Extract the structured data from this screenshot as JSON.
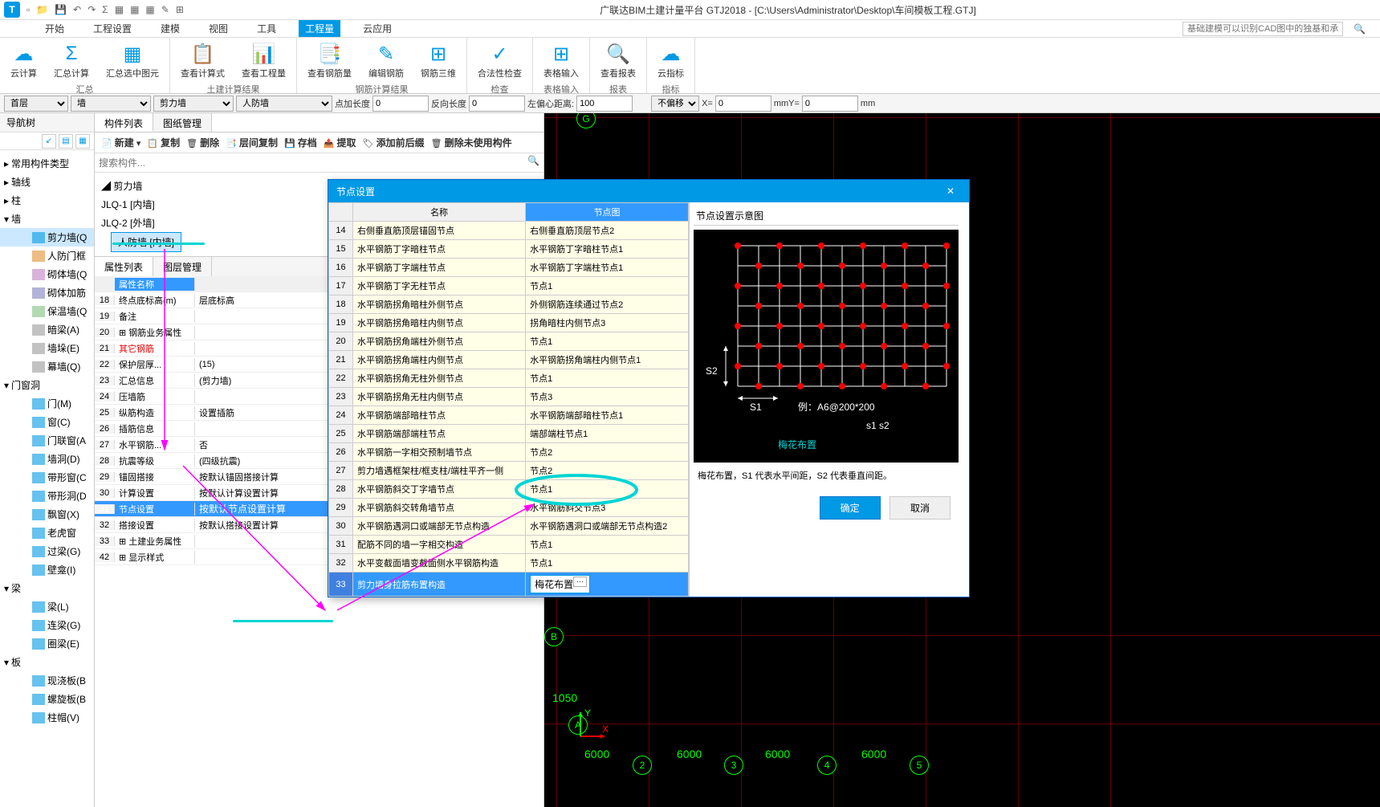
{
  "app": {
    "title": "广联达BIM土建计量平台 GTJ2018 - [C:\\Users\\Administrator\\Desktop\\车间模板工程.GTJ]"
  },
  "menu": {
    "items": [
      "开始",
      "工程设置",
      "建模",
      "视图",
      "工具",
      "工程量",
      "云应用"
    ],
    "active_index": 5,
    "search_placeholder": "基础建模可以识别CAD图中的独基和承台吗？"
  },
  "ribbon": {
    "groups": [
      {
        "label": "汇总",
        "items": [
          {
            "icon": "☁",
            "label": "云计算"
          },
          {
            "icon": "Σ",
            "label": "汇总计算"
          },
          {
            "icon": "▦",
            "label": "汇总选中图元"
          }
        ]
      },
      {
        "label": "土建计算结果",
        "items": [
          {
            "icon": "📋",
            "label": "查看计算式"
          },
          {
            "icon": "📊",
            "label": "查看工程量"
          }
        ]
      },
      {
        "label": "钢筋计算结果",
        "items": [
          {
            "icon": "📑",
            "label": "查看钢筋量"
          },
          {
            "icon": "✎",
            "label": "编辑钢筋"
          },
          {
            "icon": "⊞",
            "label": "钢筋三维"
          }
        ]
      },
      {
        "label": "检查",
        "items": [
          {
            "icon": "✓",
            "label": "合法性检查"
          }
        ]
      },
      {
        "label": "表格输入",
        "items": [
          {
            "icon": "⊞",
            "label": "表格输入"
          }
        ]
      },
      {
        "label": "报表",
        "items": [
          {
            "icon": "🔍",
            "label": "查看报表"
          }
        ]
      },
      {
        "label": "指标",
        "items": [
          {
            "icon": "☁",
            "label": "云指标"
          }
        ]
      }
    ]
  },
  "context": {
    "floor": "首层",
    "type": "墙",
    "subtype": "剪力墙",
    "member": "人防墙",
    "addlen_label": "点加长度",
    "addlen": "0",
    "revlen_label": "反向长度",
    "revlen": "0",
    "leftdist_label": "左偏心距离:",
    "leftdist": "100",
    "offset": "不偏移",
    "x_label": "X=",
    "x": "0",
    "y_label": "mmY=",
    "y": "0",
    "unit": "mm"
  },
  "nav": {
    "title": "导航树",
    "categories": [
      {
        "label": "常用构件类型"
      },
      {
        "label": "轴线"
      },
      {
        "label": "柱"
      },
      {
        "label": "墙",
        "expanded": true,
        "children": [
          {
            "label": "剪力墙(Q",
            "selected": true,
            "color": "#0099e5"
          },
          {
            "label": "人防门框",
            "color": "#e09030"
          },
          {
            "label": "砌体墙(Q",
            "color": "#c080c0"
          },
          {
            "label": "砌体加筋",
            "color": "#8080c0"
          },
          {
            "label": "保温墙(Q",
            "color": "#80c080"
          },
          {
            "label": "暗梁(A)",
            "color": "#999"
          },
          {
            "label": "墙垛(E)",
            "color": "#999"
          },
          {
            "label": "幕墙(Q)",
            "color": "#999"
          }
        ]
      },
      {
        "label": "门窗洞",
        "expanded": true,
        "children": [
          {
            "label": "门(M)"
          },
          {
            "label": "窗(C)"
          },
          {
            "label": "门联窗(A"
          },
          {
            "label": "墙洞(D)"
          },
          {
            "label": "带形窗(C"
          },
          {
            "label": "带形洞(D"
          },
          {
            "label": "飘窗(X)"
          },
          {
            "label": "老虎窗"
          },
          {
            "label": "过梁(G)"
          },
          {
            "label": "壁龛(I)"
          }
        ]
      },
      {
        "label": "梁",
        "expanded": true,
        "children": [
          {
            "label": "梁(L)"
          },
          {
            "label": "连梁(G)"
          },
          {
            "label": "圈梁(E)"
          }
        ]
      },
      {
        "label": "板",
        "expanded": true,
        "children": [
          {
            "label": "现浇板(B"
          },
          {
            "label": "螺旋板(B"
          },
          {
            "label": "柱帽(V)"
          }
        ]
      }
    ]
  },
  "member_list": {
    "tabs": [
      "构件列表",
      "图纸管理"
    ],
    "toolbar": [
      "新建",
      "复制",
      "删除",
      "层间复制",
      "存档",
      "提取",
      "添加前后缀",
      "删除未使用构件"
    ],
    "search_placeholder": "搜索构件...",
    "root": "剪力墙",
    "items": [
      "JLQ-1 [内墙]",
      "JLQ-2 [外墙]",
      "人防墙 [内墙]"
    ],
    "selected_index": 2
  },
  "props": {
    "tabs": [
      "属性列表",
      "图层管理"
    ],
    "header_name": "属性名称",
    "header_val": "",
    "rows": [
      {
        "n": "18",
        "name": "终点底标高(m)",
        "val": "层底标高"
      },
      {
        "n": "19",
        "name": "备注",
        "val": ""
      },
      {
        "n": "20",
        "name": "钢筋业务属性",
        "val": "",
        "expand": true
      },
      {
        "n": "21",
        "name": "其它钢筋",
        "val": "",
        "red": true
      },
      {
        "n": "22",
        "name": "保护层厚...",
        "val": "(15)"
      },
      {
        "n": "23",
        "name": "汇总信息",
        "val": "(剪力墙)"
      },
      {
        "n": "24",
        "name": "压墙筋",
        "val": ""
      },
      {
        "n": "25",
        "name": "纵筋构造",
        "val": "设置插筋"
      },
      {
        "n": "26",
        "name": "插筋信息",
        "val": ""
      },
      {
        "n": "27",
        "name": "水平钢筋...",
        "val": "否"
      },
      {
        "n": "28",
        "name": "抗震等级",
        "val": "(四级抗震)"
      },
      {
        "n": "29",
        "name": "锚固搭接",
        "val": "按默认锚固搭接计算"
      },
      {
        "n": "30",
        "name": "计算设置",
        "val": "按默认计算设置计算"
      },
      {
        "n": "31",
        "name": "节点设置",
        "val": "按默认节点设置计算",
        "selected": true
      },
      {
        "n": "32",
        "name": "搭接设置",
        "val": "按默认搭接设置计算"
      },
      {
        "n": "33",
        "name": "土建业务属性",
        "val": "",
        "expand": true
      },
      {
        "n": "42",
        "name": "显示样式",
        "val": "",
        "expand": true
      }
    ]
  },
  "dialog": {
    "title": "节点设置",
    "col1": "名称",
    "col2": "节点图",
    "rows": [
      {
        "n": "14",
        "name": "右侧垂直筋顶层锚固节点",
        "val": "右侧垂直筋顶层节点2"
      },
      {
        "n": "15",
        "name": "水平钢筋丁字暗柱节点",
        "val": "水平钢筋丁字暗柱节点1"
      },
      {
        "n": "16",
        "name": "水平钢筋丁字端柱节点",
        "val": "水平钢筋丁字端柱节点1"
      },
      {
        "n": "17",
        "name": "水平钢筋丁字无柱节点",
        "val": "节点1"
      },
      {
        "n": "18",
        "name": "水平钢筋拐角暗柱外侧节点",
        "val": "外侧钢筋连续通过节点2"
      },
      {
        "n": "19",
        "name": "水平钢筋拐角暗柱内侧节点",
        "val": "拐角暗柱内侧节点3"
      },
      {
        "n": "20",
        "name": "水平钢筋拐角端柱外侧节点",
        "val": "节点1"
      },
      {
        "n": "21",
        "name": "水平钢筋拐角端柱内侧节点",
        "val": "水平钢筋拐角端柱内侧节点1"
      },
      {
        "n": "22",
        "name": "水平钢筋拐角无柱外侧节点",
        "val": "节点1"
      },
      {
        "n": "23",
        "name": "水平钢筋拐角无柱内侧节点",
        "val": "节点3"
      },
      {
        "n": "24",
        "name": "水平钢筋端部暗柱节点",
        "val": "水平钢筋端部暗柱节点1"
      },
      {
        "n": "25",
        "name": "水平钢筋端部端柱节点",
        "val": "端部端柱节点1"
      },
      {
        "n": "26",
        "name": "水平钢筋一字相交预制墙节点",
        "val": "节点2"
      },
      {
        "n": "27",
        "name": "剪力墙遇框架柱/框支柱/端柱平齐一侧",
        "val": "节点2"
      },
      {
        "n": "28",
        "name": "水平钢筋斜交丁字墙节点",
        "val": "节点1"
      },
      {
        "n": "29",
        "name": "水平钢筋斜交转角墙节点",
        "val": "水平钢筋斜交节点3"
      },
      {
        "n": "30",
        "name": "水平钢筋遇洞口或端部无节点构造",
        "val": "水平钢筋遇洞口或端部无节点构造2"
      },
      {
        "n": "31",
        "name": "配筋不同的墙一字相交构造",
        "val": "节点1"
      },
      {
        "n": "32",
        "name": "水平变截面墙变截面侧水平钢筋构造",
        "val": "节点1"
      },
      {
        "n": "33",
        "name": "剪力墙身拉筋布置构造",
        "val": "梅花布置",
        "selected": true
      }
    ],
    "preview_title": "节点设置示意图",
    "preview_label_s1": "S1",
    "preview_label_s2": "S2",
    "preview_example": "例：A6@200*200",
    "preview_vars": "s1    s2",
    "preview_name": "梅花布置",
    "desc": "梅花布置，S1 代表水平间距，S2 代表垂直间距。",
    "ok": "确定",
    "cancel": "取消"
  },
  "canvas": {
    "label_g": "G",
    "label_b": "B",
    "label_a": "A",
    "label_1050": "1050",
    "axes": [
      "2",
      "3",
      "4",
      "5"
    ],
    "dims": [
      "6000",
      "6000",
      "6000",
      "6000"
    ],
    "x_label": "X",
    "y_label": "Y"
  }
}
